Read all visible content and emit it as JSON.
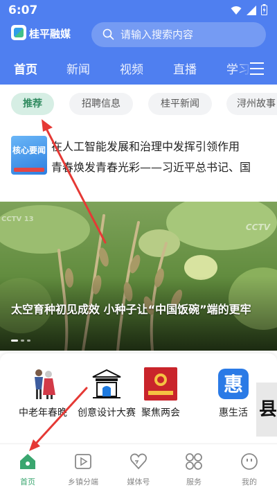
{
  "status_bar": {
    "time": "6:07"
  },
  "header": {
    "app_name": "桂平融媒",
    "search_placeholder": "请输入搜索内容",
    "tabs": [
      {
        "label": "首页",
        "active": true
      },
      {
        "label": "新闻",
        "active": false
      },
      {
        "label": "视频",
        "active": false
      },
      {
        "label": "直播",
        "active": false
      },
      {
        "label": "学习",
        "active": false
      }
    ],
    "menu_icon": "hamburger-icon"
  },
  "chips": [
    {
      "label": "推荐",
      "active": true
    },
    {
      "label": "招聘信息",
      "active": false
    },
    {
      "label": "桂平新闻",
      "active": false
    },
    {
      "label": "浔州故事",
      "active": false
    }
  ],
  "headline": {
    "badge": "核心要闻",
    "line1": "在人工智能发展和治理中发挥引领作用",
    "line2": "青春焕发青春光彩——习近平总书记、国"
  },
  "hero": {
    "title": "太空育种初见成效 小种子让“中国饭碗”端的更牢",
    "watermark_right": "CCTV",
    "watermark_left": "CCTV 13",
    "dots_total": 3,
    "dots_active_index": 0
  },
  "shortcuts": [
    {
      "label": "中老年春晚",
      "icon": "elderly-couple-icon"
    },
    {
      "label": "创意设计大赛",
      "icon": "building-design-icon"
    },
    {
      "label": "聚焦两会",
      "icon": "two-sessions-icon"
    },
    {
      "label": "惠生活",
      "icon": "hui-life-icon"
    }
  ],
  "side_strip_text": "县",
  "bottom_tabs": [
    {
      "label": "首页",
      "icon": "home-icon",
      "active": true
    },
    {
      "label": "乡镇分端",
      "icon": "video-play-icon",
      "active": false
    },
    {
      "label": "媒体号",
      "icon": "heart-media-icon",
      "active": false
    },
    {
      "label": "服务",
      "icon": "grid-service-icon",
      "active": false
    },
    {
      "label": "我的",
      "icon": "profile-face-icon",
      "active": false
    }
  ],
  "colors": {
    "header_blue": "#4f7ff0",
    "chip_active_bg": "#d6eee4",
    "accent_green": "#3aa66f",
    "annotation_red": "#e53935"
  }
}
